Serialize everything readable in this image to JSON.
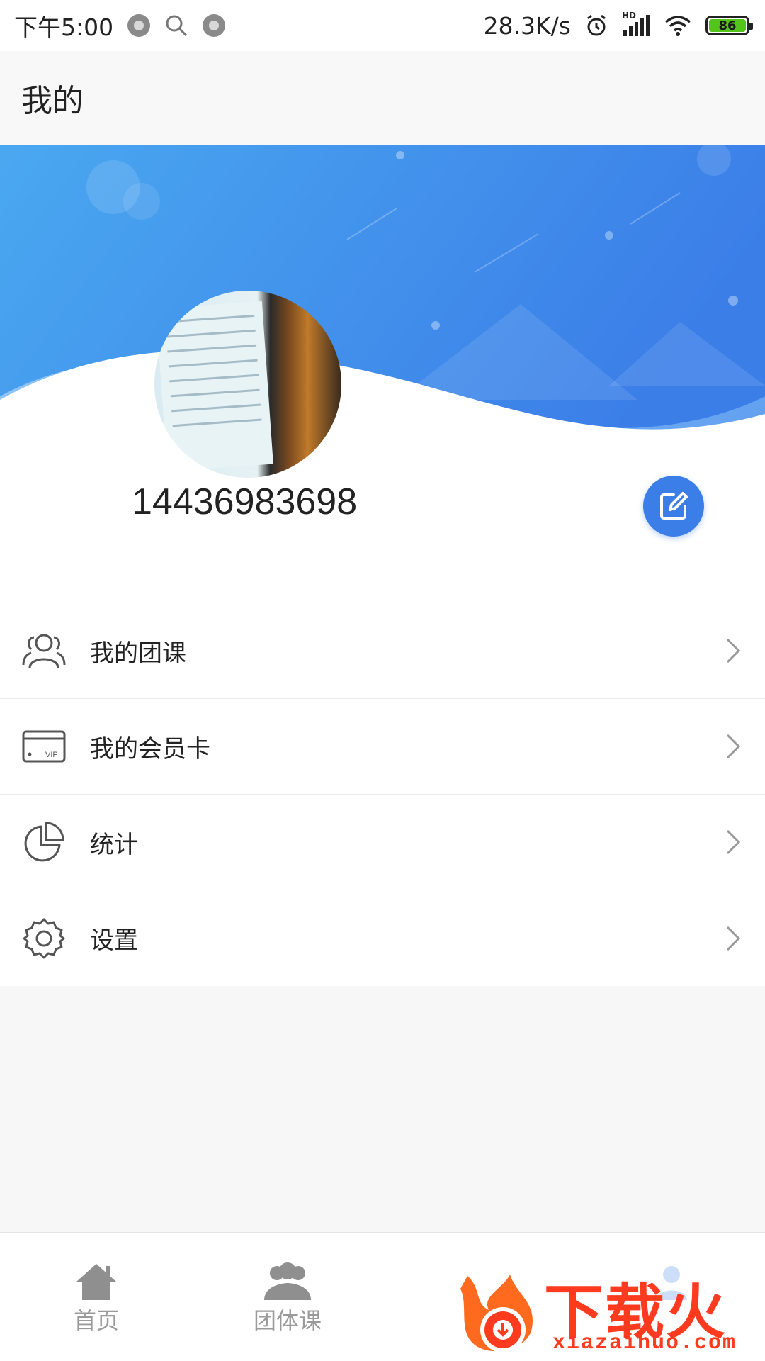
{
  "status_bar": {
    "time": "下午5:00",
    "network_speed": "28.3K/s",
    "hd_label": "HD",
    "battery": "86"
  },
  "header": {
    "title": "我的"
  },
  "profile": {
    "phone": "14436983698"
  },
  "menu": {
    "items": [
      {
        "label": "我的团课",
        "icon": "group-users-icon"
      },
      {
        "label": "我的会员卡",
        "icon": "vip-card-icon"
      },
      {
        "label": "统计",
        "icon": "pie-chart-icon"
      },
      {
        "label": "设置",
        "icon": "gear-icon"
      }
    ]
  },
  "bottom_nav": {
    "items": [
      {
        "label": "首页",
        "icon": "home-icon"
      },
      {
        "label": "团体课",
        "icon": "group-icon"
      }
    ]
  },
  "watermark": {
    "brand": "下载火",
    "url": "xiazaihuo.com"
  },
  "colors": {
    "accent": "#3b7ee8",
    "banner_start": "#4aa8f0",
    "banner_end": "#3b7ee8",
    "watermark": "#ff3b1f"
  }
}
